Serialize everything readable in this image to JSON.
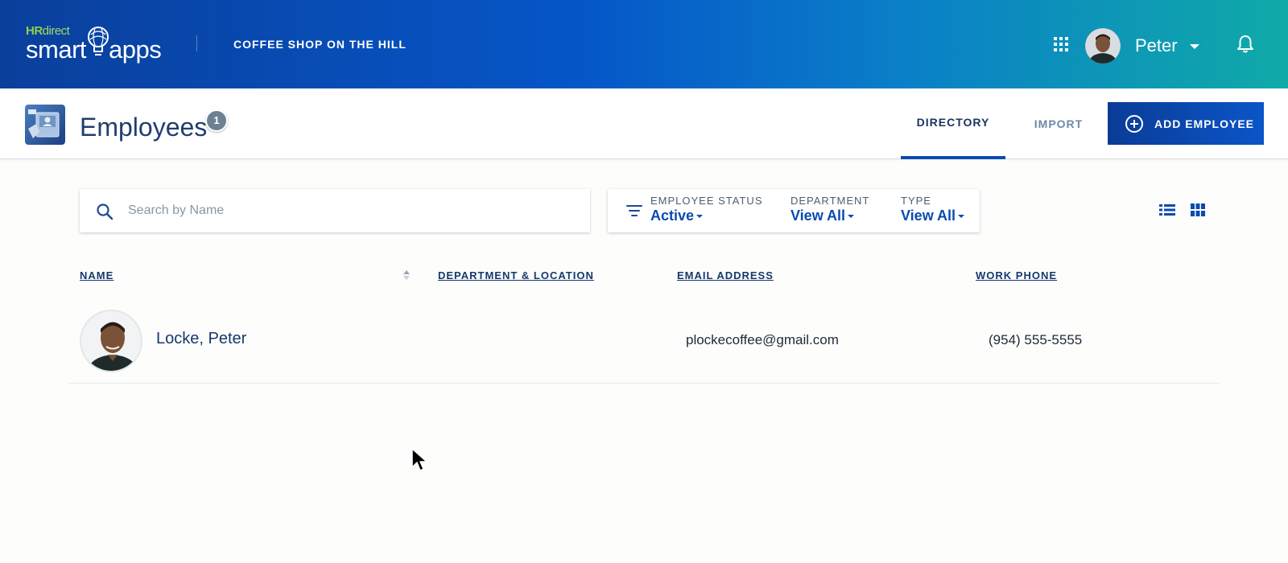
{
  "topbar": {
    "logo_hr": "HR",
    "logo_direct": "direct",
    "logo_smart": "smart",
    "logo_apps": "apps",
    "company_name": "COFFEE SHOP ON THE HILL",
    "username": "Peter",
    "icons": [
      "apps-grid-icon",
      "user-avatar",
      "chevron-down-icon",
      "bell-icon"
    ]
  },
  "header": {
    "title": "Employees",
    "count_badge": "1",
    "tabs": [
      {
        "label": "DIRECTORY",
        "active": true
      },
      {
        "label": "IMPORT",
        "active": false
      }
    ],
    "add_button_label": "ADD EMPLOYEE"
  },
  "search": {
    "placeholder": "Search by Name",
    "value": ""
  },
  "filters": {
    "status": {
      "label": "EMPLOYEE STATUS",
      "value": "Active"
    },
    "department": {
      "label": "DEPARTMENT",
      "value": "View All"
    },
    "type": {
      "label": "TYPE",
      "value": "View All"
    }
  },
  "table": {
    "columns": [
      "NAME",
      "DEPARTMENT & LOCATION",
      "EMAIL ADDRESS",
      "WORK PHONE"
    ],
    "rows": [
      {
        "name": "Locke, Peter",
        "department": "",
        "email": "plockecoffee@gmail.com",
        "phone": "(954) 555-5555"
      }
    ]
  },
  "colors": {
    "accent": "#0a4bb0",
    "header_gradient_start": "#0a3f9c",
    "header_gradient_end": "#10aaa8",
    "logo_green": "#8bd14a"
  }
}
